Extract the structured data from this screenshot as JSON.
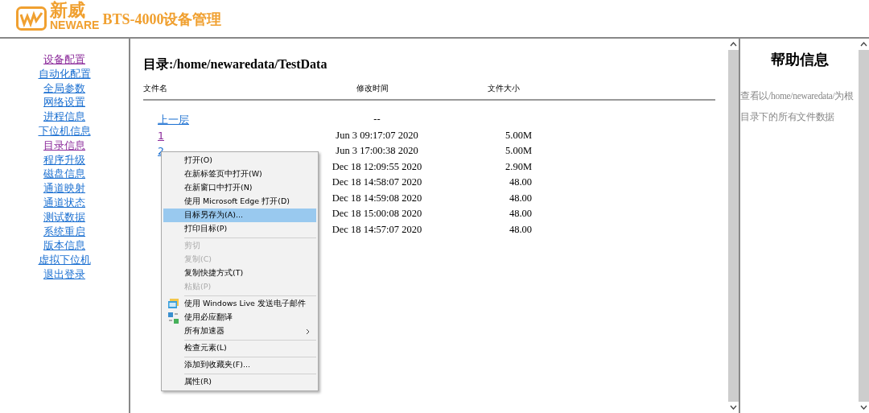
{
  "header": {
    "logo_cn": "新威",
    "logo_en": "NEWARE",
    "title": "BTS-4000设备管理"
  },
  "nav": [
    {
      "label": "设备配置",
      "visited": true
    },
    {
      "label": "自动化配置",
      "visited": false
    },
    {
      "label": "全局参数",
      "visited": false
    },
    {
      "label": "网络设置",
      "visited": false
    },
    {
      "label": "进程信息",
      "visited": false
    },
    {
      "label": "下位机信息",
      "visited": false
    },
    {
      "label": "目录信息",
      "visited": true
    },
    {
      "label": "程序升级",
      "visited": false
    },
    {
      "label": "磁盘信息",
      "visited": false
    },
    {
      "label": "通道映射",
      "visited": false
    },
    {
      "label": "通道状态",
      "visited": false
    },
    {
      "label": "测试数据",
      "visited": false
    },
    {
      "label": "系统重启",
      "visited": false
    },
    {
      "label": "版本信息",
      "visited": false
    },
    {
      "label": "虚拟下位机",
      "visited": false
    },
    {
      "label": "退出登录",
      "visited": false
    }
  ],
  "directory": {
    "title": "目录:/home/newaredata/TestData",
    "columns": [
      "文件名",
      "修改时间",
      "文件大小"
    ],
    "rows": [
      {
        "name": "上一层",
        "visited": false,
        "time": "--",
        "size": ""
      },
      {
        "name": "1",
        "visited": true,
        "time": "Jun 3 09:17:07 2020",
        "size": "5.00M"
      },
      {
        "name": "2",
        "visited": false,
        "time": "Jun 3 17:00:38 2020",
        "size": "5.00M"
      },
      {
        "time": "Dec 18 12:09:55 2020",
        "size": "2.90M"
      },
      {
        "time": "Dec 18 14:58:07 2020",
        "size": "48.00"
      },
      {
        "time": "Dec 18 14:59:08 2020",
        "size": "48.00"
      },
      {
        "time": "Dec 18 15:00:08 2020",
        "size": "48.00"
      },
      {
        "time": "Dec 18 14:57:07 2020",
        "size": "48.00"
      }
    ]
  },
  "context_menu": [
    {
      "kind": "item",
      "label": "打开(O)",
      "disabled": false,
      "selected": false
    },
    {
      "kind": "item",
      "label": "在新标签页中打开(W)",
      "disabled": false,
      "selected": false
    },
    {
      "kind": "item",
      "label": "在新窗口中打开(N)",
      "disabled": false,
      "selected": false
    },
    {
      "kind": "item",
      "label": "使用 Microsoft Edge 打开(D)",
      "disabled": false,
      "selected": false
    },
    {
      "kind": "item",
      "label": "目标另存为(A)...",
      "disabled": false,
      "selected": true
    },
    {
      "kind": "item",
      "label": "打印目标(P)",
      "disabled": false,
      "selected": false
    },
    {
      "kind": "separator"
    },
    {
      "kind": "item",
      "label": "剪切",
      "disabled": true,
      "selected": false
    },
    {
      "kind": "item",
      "label": "复制(C)",
      "disabled": true,
      "selected": false
    },
    {
      "kind": "item",
      "label": "复制快捷方式(T)",
      "disabled": false,
      "selected": false
    },
    {
      "kind": "item",
      "label": "粘贴(P)",
      "disabled": true,
      "selected": false
    },
    {
      "kind": "separator"
    },
    {
      "kind": "email",
      "label": "使用 Windows Live 发送电子邮件",
      "disabled": false,
      "selected": false
    },
    {
      "kind": "translate",
      "label": "使用必应翻译",
      "disabled": false,
      "selected": false
    },
    {
      "kind": "submenu",
      "label": "所有加速器",
      "disabled": false,
      "selected": false
    },
    {
      "kind": "separator"
    },
    {
      "kind": "item",
      "label": "检查元素(L)",
      "disabled": false,
      "selected": false
    },
    {
      "kind": "separator"
    },
    {
      "kind": "item",
      "label": "添加到收藏夹(F)...",
      "disabled": false,
      "selected": false
    },
    {
      "kind": "separator"
    },
    {
      "kind": "item",
      "label": "属性(R)",
      "disabled": false,
      "selected": false
    }
  ],
  "help": {
    "title": "帮助信息",
    "text": "查看以/home/newaredata/为根目录下的所有文件数据"
  }
}
